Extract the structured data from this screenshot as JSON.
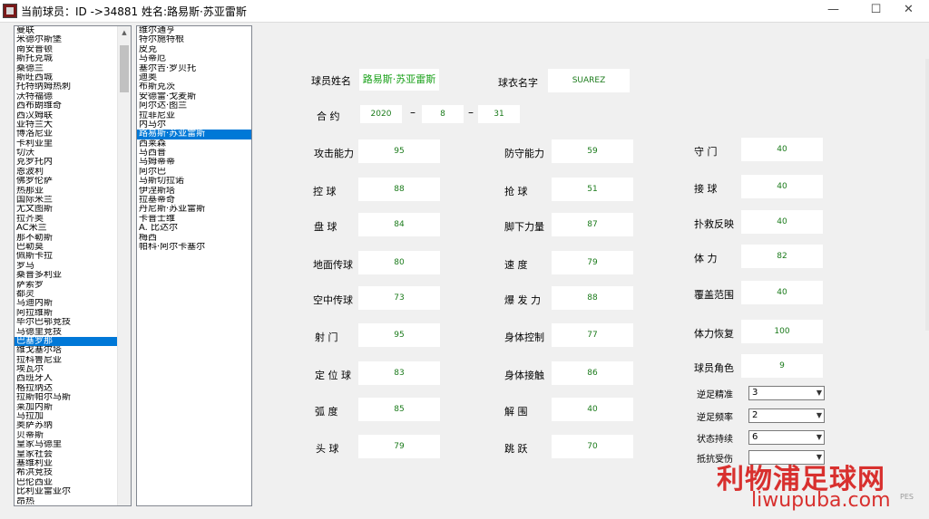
{
  "window": {
    "title": "当前球员：ID ->34881 姓名:路易斯·苏亚雷斯",
    "minimize": "—",
    "maximize": "☐",
    "close": "✕"
  },
  "teams": [
    "曼联",
    "米德尔斯堡",
    "南安普顿",
    "斯托克城",
    "桑德兰",
    "斯旺西城",
    "托特纳姆热刺",
    "沃特福德",
    "西布朗维奇",
    "西汉姆联",
    "亚特兰大",
    "博洛尼亚",
    "卡利亚里",
    "切沃",
    "克罗托内",
    "恩波利",
    "佛罗伦萨",
    "热那亚",
    "国际米兰",
    "尤文图斯",
    "拉齐奥",
    "AC米兰",
    "那不勒斯",
    "巴勒莫",
    "佩斯卡拉",
    "罗马",
    "桑普多利亚",
    "萨索罗",
    "都灵",
    "乌迪内斯",
    "阿拉维斯",
    "毕尔巴鄂竞技",
    "马德里竞技",
    "巴塞罗那",
    "维戈塞尔塔",
    "拉科鲁尼亚",
    "埃瓦尔",
    "西班牙人",
    "格拉纳达",
    "拉斯帕尔马斯",
    "莱加内斯",
    "马拉加",
    "奥萨苏纳",
    "贝蒂斯",
    "皇家马德里",
    "皇家社会",
    "塞维利亚",
    "希洪竞技",
    "巴伦西亚",
    "比利亚雷亚尔",
    "昂热"
  ],
  "teams_selected_index": 33,
  "players": [
    "维尔通亨",
    "特尔施特根",
    "皮克",
    "马蒂厄",
    "塞尔吉·罗贝托",
    "迪奥",
    "布斯克茨",
    "安德雷·戈麦斯",
    "阿尔达·图兰",
    "拉菲尼亚",
    "内马尔",
    "路易斯·苏亚雷斯",
    "西莱森",
    "马西普",
    "乌姆蒂蒂",
    "阿尔巴",
    "马斯切拉诺",
    "伊涅斯塔",
    "拉基蒂奇",
    "丹尼斯·苏亚雷斯",
    "卡普士维",
    "A. 比达尔",
    "梅西",
    "帕科·阿尔卡塞尔"
  ],
  "players_selected_index": 11,
  "form": {
    "name_label": "球员姓名",
    "name_value": "路易斯·苏亚雷斯",
    "shirt_label": "球衣名字",
    "shirt_value": "SUAREZ",
    "contract_label": "合  约",
    "contract_year": "2020",
    "contract_month": "8",
    "contract_day": "31",
    "dash": "–"
  },
  "attack": [
    {
      "label": "攻击能力",
      "value": "95"
    },
    {
      "label": "控  球",
      "value": "88"
    },
    {
      "label": "盘  球",
      "value": "84"
    },
    {
      "label": "地面传球",
      "value": "80"
    },
    {
      "label": "空中传球",
      "value": "73"
    },
    {
      "label": "射  门",
      "value": "95"
    },
    {
      "label": "定 位 球",
      "value": "83"
    },
    {
      "label": "弧  度",
      "value": "85"
    },
    {
      "label": "头  球",
      "value": "79"
    }
  ],
  "defense": [
    {
      "label": "防守能力",
      "value": "59"
    },
    {
      "label": "抢  球",
      "value": "51"
    },
    {
      "label": "脚下力量",
      "value": "87"
    },
    {
      "label": "速  度",
      "value": "79"
    },
    {
      "label": "爆 发 力",
      "value": "88"
    },
    {
      "label": "身体控制",
      "value": "77"
    },
    {
      "label": "身体接触",
      "value": "86"
    },
    {
      "label": "解  围",
      "value": "40"
    },
    {
      "label": "跳  跃",
      "value": "70"
    }
  ],
  "goalkeeper": [
    {
      "label": "守  门",
      "value": "40"
    },
    {
      "label": "接  球",
      "value": "40"
    },
    {
      "label": "扑救反映",
      "value": "40"
    },
    {
      "label": "体  力",
      "value": "82"
    },
    {
      "label": "覆盖范围",
      "value": "40"
    },
    {
      "label": "体力恢复",
      "value": "100"
    },
    {
      "label": "球员角色",
      "value": "9"
    }
  ],
  "selects": [
    {
      "label": "逆足精准",
      "value": "3"
    },
    {
      "label": "逆足频率",
      "value": "2"
    },
    {
      "label": "状态持续",
      "value": "6"
    },
    {
      "label": "抵抗受伤",
      "value": ""
    }
  ],
  "watermark": {
    "site_name": "利物浦足球网",
    "url": "liwupuba.com",
    "badge": "PES"
  }
}
